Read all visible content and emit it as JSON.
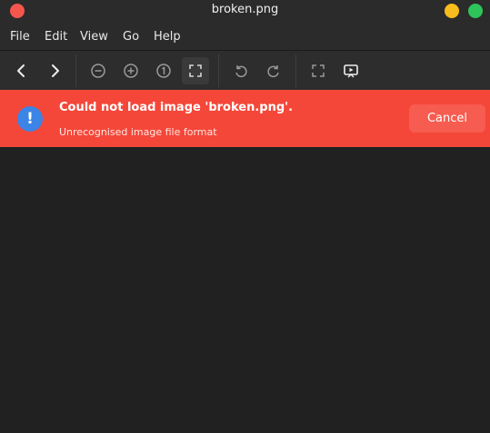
{
  "window": {
    "title": "broken.png"
  },
  "menu": [
    "File",
    "Edit",
    "View",
    "Go",
    "Help"
  ],
  "toolbar": {
    "icons": [
      "back",
      "forward",
      "zoom-out",
      "zoom-in",
      "zoom-1-to-1",
      "best-fit",
      "rotate-left",
      "rotate-right",
      "fullscreen",
      "slideshow"
    ]
  },
  "error": {
    "title": "Could not load image 'broken.png'.",
    "message": "Unrecognised image file format",
    "cancel_label": "Cancel",
    "icon": "exclamation"
  },
  "colors": {
    "infobar": "#f44739",
    "close": "#f4564e",
    "minimize": "#f8bd1c",
    "maximize": "#2fc45a",
    "info_icon": "#3c84e6"
  }
}
